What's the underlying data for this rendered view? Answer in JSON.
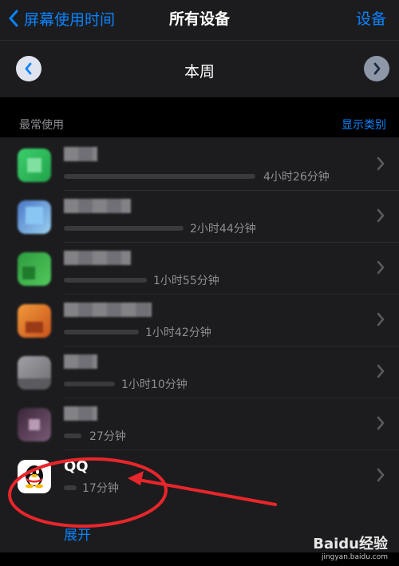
{
  "nav": {
    "back_label": "屏幕使用时间",
    "title": "所有设备",
    "right_label": "设备"
  },
  "week": {
    "title": "本周"
  },
  "section": {
    "left": "最常使用",
    "right": "显示类别"
  },
  "apps": [
    {
      "name": "",
      "time": "4小时26分钟",
      "bar_fraction": 0.55,
      "icon_color": "#2fb558"
    },
    {
      "name": "",
      "time": "2小时44分钟",
      "bar_fraction": 0.36,
      "icon_color": "#6aa7e6"
    },
    {
      "name": "",
      "time": "1小时55分钟",
      "bar_fraction": 0.24,
      "icon_color": "#2e9b3f"
    },
    {
      "name": "",
      "time": "1小时42分钟",
      "bar_fraction": 0.22,
      "icon_color": "#e0782c"
    },
    {
      "name": "",
      "time": "1小时10分钟",
      "bar_fraction": 0.16,
      "icon_color": "#8d8d93"
    },
    {
      "name": "",
      "time": "27分钟",
      "bar_fraction": 0.05,
      "icon_color": "#5b3f57"
    },
    {
      "name": "QQ",
      "time": "17分钟",
      "bar_fraction": 0.04,
      "icon_color": "#ffffff"
    }
  ],
  "expand_label": "展开",
  "watermark": {
    "brand": "Baidu经验",
    "url": "jingyan.baidu.com"
  },
  "colors": {
    "accent": "#0a84ff",
    "annotation": "#e8262b"
  }
}
